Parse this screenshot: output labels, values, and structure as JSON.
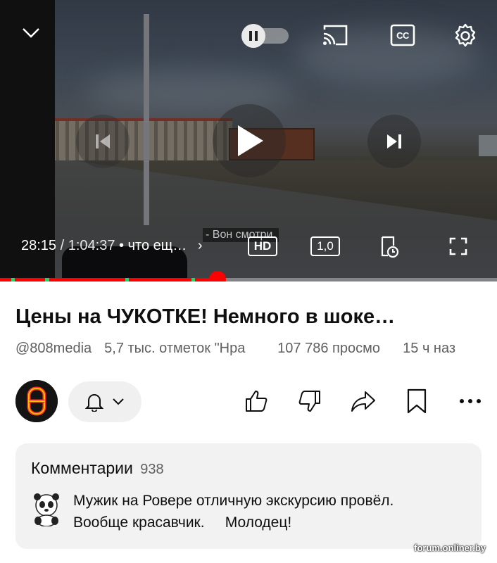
{
  "player": {
    "time_current": "28:15",
    "time_separator": "/",
    "time_total": "1:04:37",
    "chapter_dot": "•",
    "chapter_title": "что ещ…",
    "chapter_chevron": "›",
    "subtitle": "- Вон смотри.",
    "quality_label": "HD",
    "speed_label": "1,0",
    "cc_label": "CC",
    "progress_fraction": 0.437
  },
  "video": {
    "title": "Цены на ЧУКОТКЕ! Немного в шоке…",
    "channel_handle": "@808media",
    "likes_text": "5,7 тыс. отметок \"Нра",
    "views_text": "107 786 просмо",
    "age_text": "15 ч наз"
  },
  "comments": {
    "heading": "Комментарии",
    "count": "938",
    "top_comment": "Мужик на Ровере отличную экскурсию провёл.\nВообще красавчик.     Молодец!"
  },
  "watermark": "forum.onliner.by",
  "colors": {
    "accent": "#ff0000",
    "chip_bg": "#f0f0f0",
    "comment_bg": "#f2f2f2"
  }
}
